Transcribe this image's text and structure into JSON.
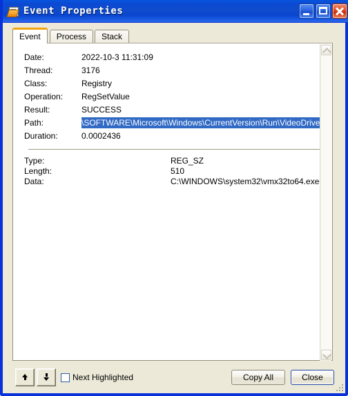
{
  "window": {
    "title": "Event Properties",
    "icon": "event-properties-icon",
    "frame_color": "#0831d9",
    "titlebar_color": "#0b4ad2",
    "controls": {
      "minimize": "Minimize",
      "maximize": "Maximize",
      "close": "Close"
    }
  },
  "tabs": [
    {
      "label": "Event",
      "active": true
    },
    {
      "label": "Process",
      "active": false
    },
    {
      "label": "Stack",
      "active": false
    }
  ],
  "event": {
    "fields": [
      {
        "label": "Date:",
        "value": "2022-10-3 11:31:09",
        "selected": false
      },
      {
        "label": "Thread:",
        "value": "3176",
        "selected": false
      },
      {
        "label": "Class:",
        "value": "Registry",
        "selected": false
      },
      {
        "label": "Operation:",
        "value": "RegSetValue",
        "selected": false
      },
      {
        "label": "Result:",
        "value": "SUCCESS",
        "selected": false
      },
      {
        "label": "Path:",
        "value": "\\SOFTWARE\\Microsoft\\Windows\\CurrentVersion\\Run\\VideoDriver",
        "selected": true
      },
      {
        "label": "Duration:",
        "value": "0.0002436",
        "selected": false
      }
    ],
    "details": [
      {
        "label": "Type:",
        "value": "REG_SZ"
      },
      {
        "label": "Length:",
        "value": "510"
      },
      {
        "label": "Data:",
        "value": "C:\\WINDOWS\\system32\\vmx32to64.exe"
      }
    ],
    "selection_color": "#316ac5"
  },
  "footer": {
    "prev_button": "Previous event",
    "next_button": "Next event",
    "next_highlighted_label": "Next Highlighted",
    "next_highlighted_checked": false,
    "copy_all_label": "Copy All",
    "close_label": "Close"
  }
}
